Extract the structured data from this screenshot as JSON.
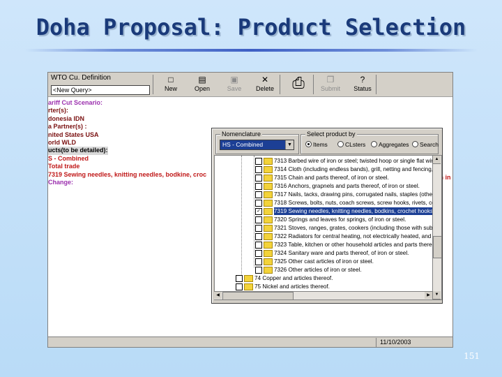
{
  "slide": {
    "title": "Doha Proposal: Product Selection",
    "page_number": "151"
  },
  "app": {
    "definition_label": "WTO Cu. Definition",
    "query_select_value": "<New Query>",
    "toolbar": [
      {
        "label": "New",
        "icon": "new-document-icon",
        "glyph": "□",
        "disabled": false
      },
      {
        "label": "Open",
        "icon": "open-folder-icon",
        "glyph": "▤",
        "disabled": false
      },
      {
        "label": "Save",
        "icon": "save-disk-icon",
        "glyph": "▣",
        "disabled": true
      },
      {
        "label": "Delete",
        "icon": "delete-x-icon",
        "glyph": "✕",
        "disabled": false
      },
      {
        "label": "",
        "icon": "printer-icon",
        "glyph": "⎙",
        "disabled": false
      },
      {
        "label": "Submit",
        "icon": "submit-icon",
        "glyph": "❐",
        "disabled": true
      },
      {
        "label": "Status",
        "icon": "status-help-icon",
        "glyph": "?",
        "disabled": false
      }
    ],
    "left_panel": [
      {
        "text": "ariff Cut Scenario:",
        "style": "purple"
      },
      {
        "text": "rter(s):",
        "style": "dark"
      },
      {
        "text": "donesia  IDN",
        "style": "dark"
      },
      {
        "text": "a Partner(s) :",
        "style": "dark"
      },
      {
        "text": "nited States  USA",
        "style": "dark"
      },
      {
        "text": "orld  WLD",
        "style": "dark"
      },
      {
        "text": "ucts(to be detailed):",
        "style": "sel"
      },
      {
        "text": "S - Combined",
        "style": "red"
      },
      {
        "text": "  Total trade",
        "style": "red"
      },
      {
        "text": "  7319  Sewing needles, knitting needles, bodkine, croc",
        "style": "red"
      },
      {
        "text": "  Change:",
        "style": "purple"
      }
    ],
    "left_panel_overflow": "on in",
    "status_date": "11/10/2003"
  },
  "dialog": {
    "nomenclature_title": "Nomenclature",
    "nomenclature_value": "HS - Combined",
    "select_title": "Select product by",
    "radio_options": [
      {
        "label": "Items",
        "selected": true
      },
      {
        "label": "CLsters",
        "selected": false
      },
      {
        "label": "Aggregates",
        "selected": false
      },
      {
        "label": "Search",
        "selected": false
      }
    ],
    "tree_items": [
      {
        "code": "7313",
        "text": "Barbed wire of iron or steel; twisted hoop or single flat wire",
        "checked": false,
        "selected": false,
        "level": 2
      },
      {
        "code": "7314",
        "text": "Cloth (including endless bands), grill, netting and fencing, c",
        "checked": false,
        "selected": false,
        "level": 2
      },
      {
        "code": "7315",
        "text": "Chain and parts thereof, of iron or steel.",
        "checked": false,
        "selected": false,
        "level": 2
      },
      {
        "code": "7316",
        "text": "Anchors, grapnels and parts thereof, of iron or steel.",
        "checked": false,
        "selected": false,
        "level": 2
      },
      {
        "code": "7317",
        "text": "Nails, tacks, drawing pins, corrugated nails, staples (other",
        "checked": false,
        "selected": false,
        "level": 2
      },
      {
        "code": "7318",
        "text": "Screws, bolts, nuts, coach screws, screw hooks, rivets, cot",
        "checked": false,
        "selected": false,
        "level": 2
      },
      {
        "code": "7319",
        "text": "Sewing needles, knitting needles, bodkins, crochet hooks",
        "checked": true,
        "selected": true,
        "level": 2
      },
      {
        "code": "7320",
        "text": "Springs and leaves for springs, of iron or steel.",
        "checked": false,
        "selected": false,
        "level": 2
      },
      {
        "code": "7321",
        "text": "Stoves, ranges, grates, cookers (including those with subs",
        "checked": false,
        "selected": false,
        "level": 2
      },
      {
        "code": "7322",
        "text": "Radiators for central heating, not electrically heated, and p",
        "checked": false,
        "selected": false,
        "level": 2
      },
      {
        "code": "7323",
        "text": "Table, kitchen or other household articles and parts thereo",
        "checked": false,
        "selected": false,
        "level": 2
      },
      {
        "code": "7324",
        "text": "Sanitary ware and parts thereof, of iron or steel.",
        "checked": false,
        "selected": false,
        "level": 2
      },
      {
        "code": "7325",
        "text": "Other cast articles of iron or steel.",
        "checked": false,
        "selected": false,
        "level": 2
      },
      {
        "code": "7326",
        "text": "Other articles of iron or steel.",
        "checked": false,
        "selected": false,
        "level": 2
      },
      {
        "code": "74",
        "text": "Copper and articles thereof.",
        "checked": false,
        "selected": false,
        "level": 1
      },
      {
        "code": "75",
        "text": "Nickel and articles thereof.",
        "checked": false,
        "selected": false,
        "level": 1
      }
    ]
  },
  "colors": {
    "title": "#1a3a7a",
    "selection": "#1c3f95",
    "window_face": "#d4d0c8"
  }
}
